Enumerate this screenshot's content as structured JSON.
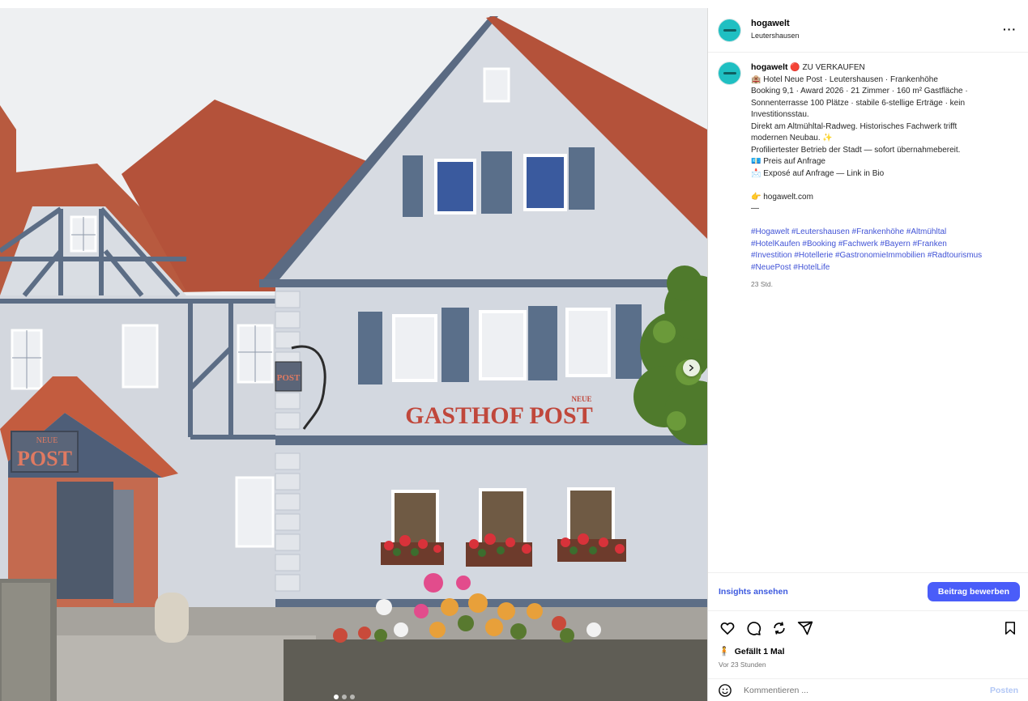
{
  "post": {
    "username": "hogawelt",
    "location": "Leutershausen",
    "more_icon": "more-horizontal-icon",
    "caption_lines": [
      "🔴 ZU VERKAUFEN",
      "🏨 Hotel Neue Post · Leutershausen · Frankenhöhe",
      "Booking 9,1 · Award 2026 · 21 Zimmer · 160 m² Gastfläche ·",
      "Sonnenterrasse 100 Plätze · stabile 6-stellige Erträge · kein",
      "Investitionsstau.",
      "Direkt am Altmühltal-Radweg. Historisches Fachwerk trifft",
      "modernen Neubau. ✨",
      "Profiliertester Betrieb der Stadt — sofort übernahmebereit.",
      "💶 Preis auf Anfrage",
      "📩 Exposé auf Anfrage — Link in Bio",
      "",
      "👉 hogawelt.com",
      "—"
    ],
    "hashtag_lines": [
      "#Hogawelt #Leutershausen #Frankenhöhe #Altmühltal",
      "#HotelKaufen #Booking #Fachwerk #Bayern #Franken",
      "#Investition #Hotellerie #GastronomieImmobilien #Radtourismus",
      "#NeuePost #HotelLife"
    ],
    "caption_time": "23 Std.",
    "insights_label": "Insights ansehen",
    "promote_label": "Beitrag bewerben",
    "likes_text": "Gefällt 1 Mal",
    "posted_ago": "Vor 23 Stunden",
    "comment_placeholder": "Kommentieren ...",
    "post_button": "Posten"
  },
  "photo": {
    "sign_main": "GASTHOF POST",
    "sign_neue": "NEUE",
    "entrance_sign_neue": "NEUE",
    "entrance_sign_post": "POST",
    "hanging_sign": "POST",
    "carousel_dots": 3,
    "active_dot": 0
  },
  "colors": {
    "accent_blue": "#4a5df9",
    "hashtag_blue": "#4153d6",
    "avatar_teal": "#1fbfc2",
    "sign_red": "#c0473b",
    "shutter_blue": "#5a6f8a",
    "roof_red": "#b8563c"
  }
}
